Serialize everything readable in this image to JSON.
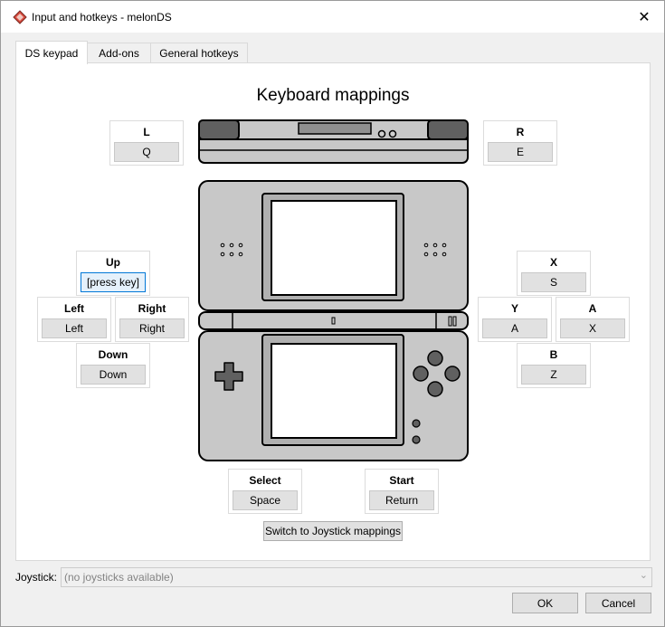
{
  "window": {
    "title": "Input and hotkeys - melonDS",
    "close_glyph": "✕"
  },
  "tabs": [
    {
      "label": "DS keypad",
      "active": true
    },
    {
      "label": "Add-ons",
      "active": false
    },
    {
      "label": "General hotkeys",
      "active": false
    }
  ],
  "panel": {
    "heading": "Keyboard mappings",
    "switch_label": "Switch to Joystick mappings"
  },
  "keys": {
    "L": {
      "label": "L",
      "value": "Q"
    },
    "R": {
      "label": "R",
      "value": "E"
    },
    "up": {
      "label": "Up",
      "value": "[press key]"
    },
    "left": {
      "label": "Left",
      "value": "Left"
    },
    "right": {
      "label": "Right",
      "value": "Right"
    },
    "down": {
      "label": "Down",
      "value": "Down"
    },
    "x": {
      "label": "X",
      "value": "S"
    },
    "y": {
      "label": "Y",
      "value": "A"
    },
    "a": {
      "label": "A",
      "value": "X"
    },
    "b": {
      "label": "B",
      "value": "Z"
    },
    "select": {
      "label": "Select",
      "value": "Space"
    },
    "start": {
      "label": "Start",
      "value": "Return"
    }
  },
  "joystick": {
    "label": "Joystick:",
    "value": "(no joysticks available)"
  },
  "buttons": {
    "ok": "OK",
    "cancel": "Cancel"
  },
  "colors": {
    "accent": "#0078d7",
    "console_body": "#c0c0c0",
    "console_outline": "#000000"
  }
}
